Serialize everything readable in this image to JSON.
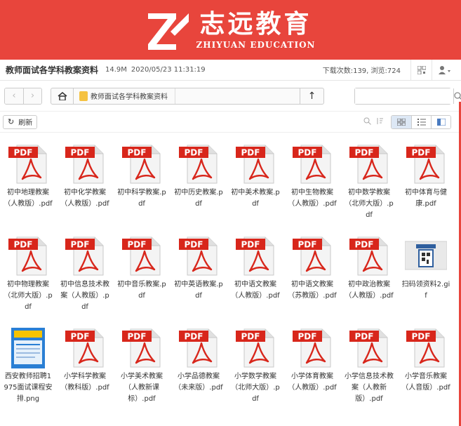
{
  "brand": {
    "name_cn": "志远教育",
    "name_en": "ZHIYUAN EDUCATION"
  },
  "header": {
    "title": "教师面试各学科教案资料",
    "size": "14.9M",
    "date": "2020/05/23 11:31:19",
    "stats": "下载次数:139, 浏览:724"
  },
  "nav": {
    "breadcrumb": "教师面试各学科教案资料",
    "search_placeholder": ""
  },
  "toolbar": {
    "refresh_label": "刷新"
  },
  "icons": {
    "pdf_label": "PDF"
  },
  "files": [
    {
      "name": "初中地理教案（人教版）.pdf",
      "type": "pdf"
    },
    {
      "name": "初中化学教案（人教版）.pdf",
      "type": "pdf"
    },
    {
      "name": "初中科学教案.pdf",
      "type": "pdf"
    },
    {
      "name": "初中历史教案.pdf",
      "type": "pdf"
    },
    {
      "name": "初中美术教案.pdf",
      "type": "pdf"
    },
    {
      "name": "初中生物教案（人教版）.pdf",
      "type": "pdf"
    },
    {
      "name": "初中数学教案（北师大版）.pdf",
      "type": "pdf"
    },
    {
      "name": "初中体育与健康.pdf",
      "type": "pdf"
    },
    {
      "name": "初中物理教案（北师大版）.pdf",
      "type": "pdf"
    },
    {
      "name": "初中信息技术教案（人教版）.pdf",
      "type": "pdf"
    },
    {
      "name": "初中音乐教案.pdf",
      "type": "pdf"
    },
    {
      "name": "初中英语教案.pdf",
      "type": "pdf"
    },
    {
      "name": "初中语文教案（人教版）.pdf",
      "type": "pdf"
    },
    {
      "name": "初中语文教案（苏教版）.pdf",
      "type": "pdf"
    },
    {
      "name": "初中政治教案（人教版）.pdf",
      "type": "pdf"
    },
    {
      "name": "扫码领资料2.gif",
      "type": "gif"
    },
    {
      "name": "西安教师招聘1975面试课程安排.png",
      "type": "png"
    },
    {
      "name": "小学科学教案（教科版）.pdf",
      "type": "pdf"
    },
    {
      "name": "小学美术教案（人教新课标）.pdf",
      "type": "pdf"
    },
    {
      "name": "小学品德教案（未来版）.pdf",
      "type": "pdf"
    },
    {
      "name": "小学数学教案（北师大版）.pdf",
      "type": "pdf"
    },
    {
      "name": "小学体育教案（人教版）.pdf",
      "type": "pdf"
    },
    {
      "name": "小学信息技术教案（人教新版）.pdf",
      "type": "pdf"
    },
    {
      "name": "小学音乐教案（人音版）.pdf",
      "type": "pdf"
    }
  ]
}
